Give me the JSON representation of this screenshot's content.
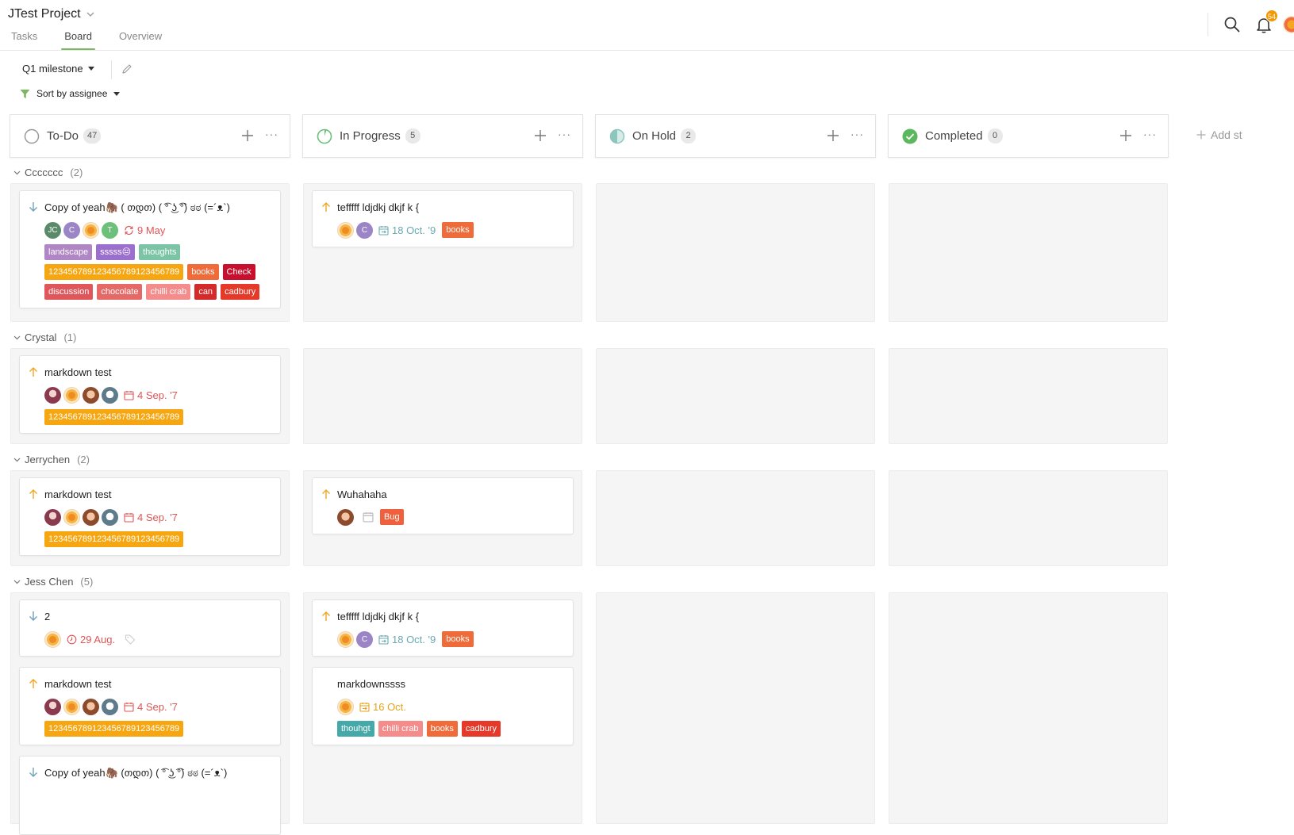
{
  "project": {
    "title": "JTest Project"
  },
  "tabs": [
    {
      "label": "Tasks",
      "active": false
    },
    {
      "label": "Board",
      "active": true
    },
    {
      "label": "Overview",
      "active": false
    }
  ],
  "header_right": {
    "notification_count": "54"
  },
  "filters": {
    "milestone": "Q1 milestone",
    "sort": "Sort by assignee"
  },
  "columns": [
    {
      "name": "To-Do",
      "count": "47"
    },
    {
      "name": "In Progress",
      "count": "5"
    },
    {
      "name": "On Hold",
      "count": "2"
    },
    {
      "name": "Completed",
      "count": "0"
    }
  ],
  "add_status_label": "Add st",
  "colors": {
    "accent": "#7bb661",
    "notification": "#f39800",
    "due_red": "#e05555",
    "due_teal": "#6aa9b0",
    "due_orange": "#e6a219"
  },
  "lanes": [
    {
      "name": "Ccccccc",
      "count": "(2)",
      "todo": [
        {
          "title": "Copy of yeah🦣 ( თდთ) ( ͡° ͜ʖ ͡°) ಠಠ (=´ᴥ`)",
          "due": "9 May",
          "tags": [
            "landscape",
            "sssss😔",
            "thoughts",
            "123456789123456789123456789",
            "books",
            "Check",
            "discussion",
            "chocolate",
            "chilli crab",
            "can",
            "cadbury"
          ]
        }
      ],
      "progress": [
        {
          "title": "tefffff ldjdkj dkjf k {",
          "due": "18 Oct. '9",
          "tags": [
            "books"
          ]
        }
      ]
    },
    {
      "name": "Crystal",
      "count": "(1)",
      "todo": [
        {
          "title": "markdown test",
          "due": "4 Sep. '7",
          "tags": [
            "123456789123456789123456789"
          ]
        }
      ]
    },
    {
      "name": "Jerrychen",
      "count": "(2)",
      "todo": [
        {
          "title": "markdown test",
          "due": "4 Sep. '7",
          "tags": [
            "123456789123456789123456789"
          ]
        }
      ],
      "progress": [
        {
          "title": "Wuhahaha",
          "tags": [
            "Bug"
          ]
        }
      ]
    },
    {
      "name": "Jess Chen",
      "count": "(5)",
      "todo": [
        {
          "title": "2",
          "due": "29 Aug."
        },
        {
          "title": "markdown test",
          "due": "4 Sep. '7",
          "tags": [
            "123456789123456789123456789"
          ]
        },
        {
          "title": "Copy of yeah🦣 (თდთ) ( ͡° ͜ʖ ͡°) ಠಠ (=´ᴥ`)"
        }
      ],
      "progress": [
        {
          "title": "tefffff ldjdkj dkjf k {",
          "due": "18 Oct. '9",
          "tags": [
            "books"
          ]
        },
        {
          "title": "markdownssss",
          "due": "16 Oct.",
          "tags": [
            "thouhgt",
            "chilli crab",
            "books",
            "cadbury"
          ]
        }
      ]
    }
  ],
  "avatar_initials": {
    "jc": "JC",
    "c": "C",
    "t": "T"
  }
}
